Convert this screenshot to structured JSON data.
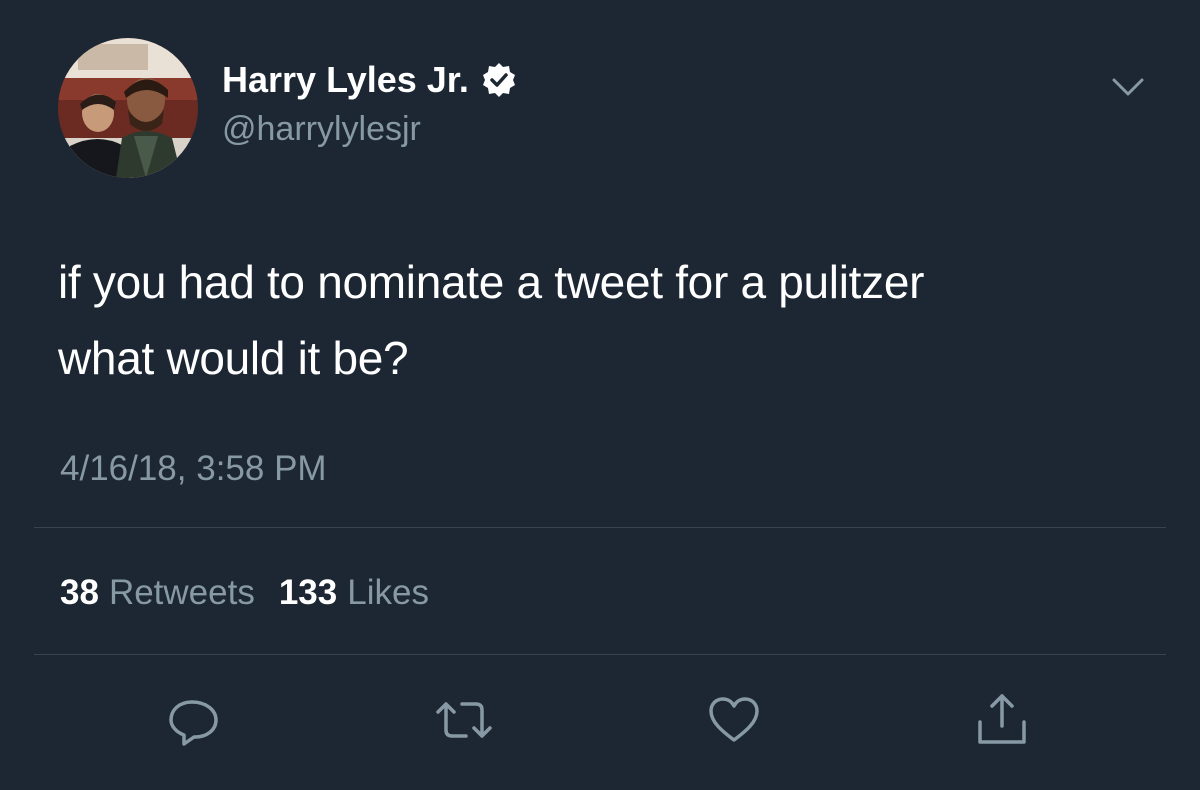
{
  "author": {
    "name": "Harry Lyles Jr.",
    "handle": "@harrylylesjr",
    "verified": true
  },
  "tweet": {
    "text_lines": [
      "if you had to nominate a tweet for a pulitzer",
      "what would it be?"
    ],
    "timestamp": "4/16/18, 3:58 PM"
  },
  "stats": {
    "retweets_count": "38",
    "retweets_label": "Retweets",
    "likes_count": "133",
    "likes_label": "Likes"
  },
  "icons": {
    "verified": "verified-badge-icon",
    "menu": "chevron-down-icon",
    "reply": "reply-bubble-icon",
    "retweet": "retweet-icon",
    "like": "heart-icon",
    "share": "share-icon"
  },
  "colors": {
    "background": "#1c2733",
    "text": "#ffffff",
    "muted": "#8899a6",
    "divider": "#38444d"
  }
}
